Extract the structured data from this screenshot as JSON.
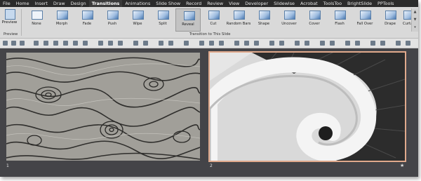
{
  "menu": {
    "tabs": [
      {
        "label": "File"
      },
      {
        "label": "Home"
      },
      {
        "label": "Insert"
      },
      {
        "label": "Draw"
      },
      {
        "label": "Design"
      },
      {
        "label": "Transitions"
      },
      {
        "label": "Animations"
      },
      {
        "label": "Slide Show"
      },
      {
        "label": "Record"
      },
      {
        "label": "Review"
      },
      {
        "label": "View"
      },
      {
        "label": "Developer"
      },
      {
        "label": "Slidewise"
      },
      {
        "label": "Acrobat"
      },
      {
        "label": "ToolsToo"
      },
      {
        "label": "BrightSlide"
      },
      {
        "label": "PPTools"
      }
    ],
    "active_tab": "Transitions"
  },
  "ribbon": {
    "preview_label": "Preview",
    "preview_group_label": "Preview",
    "transitions_group_label": "Transition to This Slide",
    "transitions": [
      {
        "label": "None"
      },
      {
        "label": "Morph"
      },
      {
        "label": "Fade"
      },
      {
        "label": "Push"
      },
      {
        "label": "Wipe"
      },
      {
        "label": "Split"
      },
      {
        "label": "Reveal"
      },
      {
        "label": "Cut"
      },
      {
        "label": "Random Bars"
      },
      {
        "label": "Shape"
      },
      {
        "label": "Uncover"
      },
      {
        "label": "Cover"
      },
      {
        "label": "Flash"
      },
      {
        "label": "Fall Over"
      },
      {
        "label": "Drape"
      },
      {
        "label": "Curtains"
      }
    ],
    "selected_transition": "Reveal"
  },
  "slides": [
    {
      "number": "1",
      "image": "wood-grain-photo"
    },
    {
      "number": "2",
      "image": "spiral-staircase-photo",
      "selected": true
    }
  ],
  "colors": {
    "menubar": "#2b2b2b",
    "ribbon": "#d9d9d9",
    "slide_area": "#444448",
    "selected_outline": "#e0a98c"
  }
}
